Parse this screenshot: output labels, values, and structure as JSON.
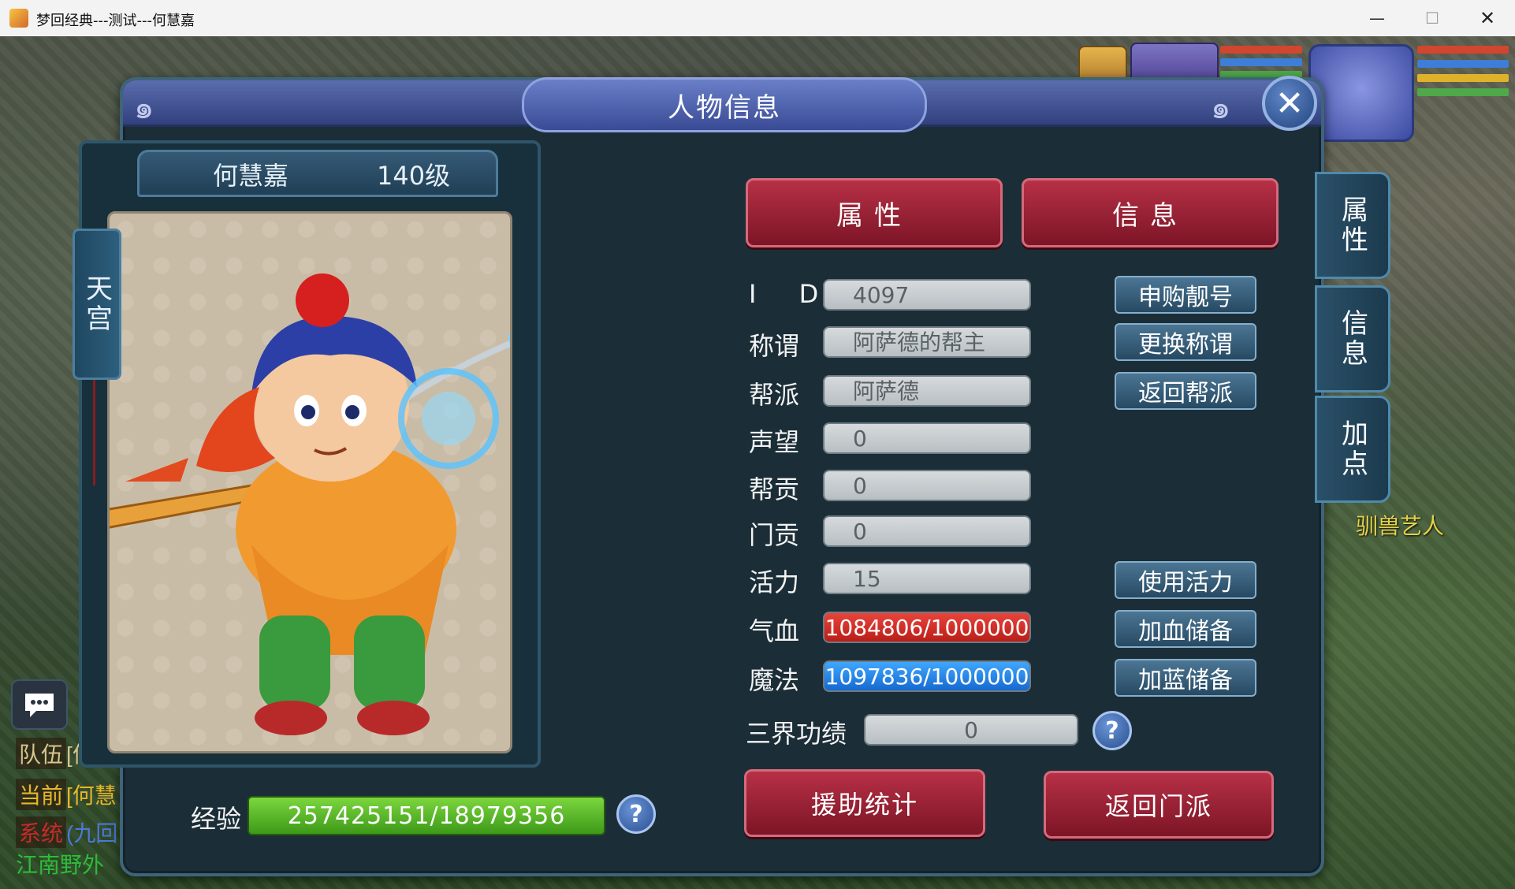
{
  "window": {
    "title": "梦回经典---测试---何慧嘉",
    "minimize_glyph": "—",
    "maximize_glyph": "☐",
    "close_glyph": "✕"
  },
  "panel": {
    "title": "人物信息",
    "close_glyph": "✕"
  },
  "character": {
    "name": "何慧嘉",
    "level": "140级",
    "faction": "天宫"
  },
  "tabs": {
    "attributes": "属性",
    "info": "信息"
  },
  "side_tabs": [
    "属性",
    "信息",
    "加点"
  ],
  "rows": {
    "id": {
      "label": "I D",
      "value": "4097",
      "button": "申购靓号"
    },
    "title": {
      "label": "称谓",
      "value": "阿萨德的帮主",
      "button": "更换称谓"
    },
    "guild": {
      "label": "帮派",
      "value": "阿萨德",
      "button": "返回帮派"
    },
    "reputation": {
      "label": "声望",
      "value": "0"
    },
    "guild_contrib": {
      "label": "帮贡",
      "value": "0"
    },
    "sect_contrib": {
      "label": "门贡",
      "value": "0"
    },
    "vitality": {
      "label": "活力",
      "value": "15",
      "button": "使用活力"
    },
    "hp": {
      "label": "气血",
      "value": "1084806/1000000",
      "button": "加血储备"
    },
    "mp": {
      "label": "魔法",
      "value": "1097836/1000000",
      "button": "加蓝储备"
    },
    "merit": {
      "label": "三界功绩",
      "value": "0"
    }
  },
  "bottom_buttons": {
    "assist_stats": "援助统计",
    "return_sect": "返回门派"
  },
  "experience": {
    "label": "经验",
    "value": "257425151/18979356"
  },
  "help_glyph": "?",
  "chat": {
    "lines": [
      {
        "tag": "队伍",
        "text": "[何慧"
      },
      {
        "tag": "当前",
        "text": "[何慧"
      },
      {
        "tag": "系统",
        "text": "(九回"
      },
      {
        "tag": "",
        "text": "江南野外"
      }
    ]
  },
  "npc_label": "驯兽艺人",
  "colors": {
    "red_button": "#a52238",
    "hp_bar": "#d63029",
    "mp_bar": "#2b8cf0",
    "exp_bar": "#5cbd2a",
    "panel_bg": "#1b2e38"
  }
}
